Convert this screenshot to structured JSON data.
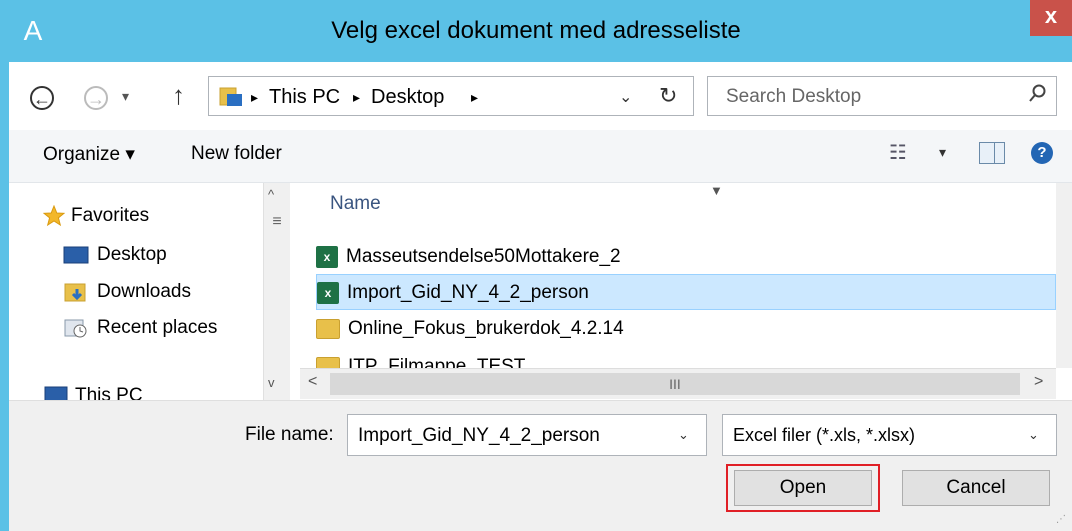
{
  "window": {
    "title": "Velg excel dokument med adresseliste",
    "close_label": "x",
    "app_icon_glyph": "A"
  },
  "nav": {
    "back_glyph": "←",
    "forward_glyph": "→",
    "recent_glyph": "▾",
    "up_glyph": "↑",
    "breadcrumbs": [
      "This PC",
      "Desktop"
    ],
    "sep_glyph": "▸",
    "dropdown_glyph": "⌄",
    "refresh_glyph": "↻"
  },
  "search": {
    "placeholder": "Search Desktop",
    "icon_glyph": "⚲"
  },
  "toolbar": {
    "organize_label": "Organize ▾",
    "new_folder_label": "New folder",
    "view_glyph": "☷",
    "view_drop_glyph": "▾",
    "help_glyph": "?"
  },
  "navpane": {
    "items": [
      {
        "label": "Favorites",
        "icon": "star-icon"
      },
      {
        "label": "Desktop",
        "icon": "desktop-icon"
      },
      {
        "label": "Downloads",
        "icon": "downloads-icon"
      },
      {
        "label": "Recent places",
        "icon": "recent-places-icon"
      },
      {
        "label": "This PC",
        "icon": "this-pc-icon"
      }
    ],
    "scroll_up": "^",
    "scroll_grip": "≡",
    "scroll_down": "v"
  },
  "filelist": {
    "column_name": "Name",
    "sort_glyph": "▼",
    "files": [
      {
        "name": "Masseutsendelse50Mottakere_2",
        "type": "excel",
        "selected": false
      },
      {
        "name": "Import_Gid_NY_4_2_person",
        "type": "excel",
        "selected": true
      },
      {
        "name": "Online_Fokus_brukerdok_4.2.14",
        "type": "folder",
        "selected": false
      },
      {
        "name": "ITP_Filmappe_TEST",
        "type": "folder",
        "selected": false
      }
    ],
    "excel_glyph": "x",
    "hscroll_left": "<",
    "hscroll_grip": "III",
    "hscroll_right": ">"
  },
  "bottom": {
    "file_name_label": "File name:",
    "file_name_value": "Import_Gid_NY_4_2_person",
    "filter_value": "Excel filer (*.xls, *.xlsx)",
    "dropdown_glyph": "⌄",
    "open_label": "Open",
    "cancel_label": "Cancel"
  },
  "colors": {
    "titlebar": "#5bc1e6",
    "close": "#c9524a",
    "selection": "#cce8ff",
    "focus_outline": "#e01f26"
  }
}
